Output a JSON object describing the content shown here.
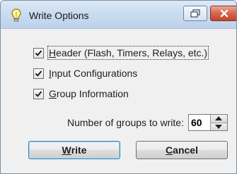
{
  "window": {
    "title": "Write Options"
  },
  "options": [
    {
      "label": "Header (Flash, Timers, Relays, etc.)",
      "checked": true
    },
    {
      "label": "Input Configurations",
      "checked": true
    },
    {
      "label": "Group Information",
      "checked": true
    }
  ],
  "groups": {
    "label": "Number of groups to write:",
    "value": "60"
  },
  "buttons": {
    "write": "Write",
    "cancel": "Cancel"
  },
  "colors": {
    "titlebar": "#c9dbef",
    "close_button": "#d66a51",
    "dialog_background": "#f0f0f0"
  },
  "icons": {
    "title": "lightbulb-icon",
    "restore": "restore-window-icon",
    "close": "close-icon",
    "check": "checkmark-icon",
    "spin_up": "arrow-up-icon",
    "spin_down": "arrow-down-icon"
  }
}
